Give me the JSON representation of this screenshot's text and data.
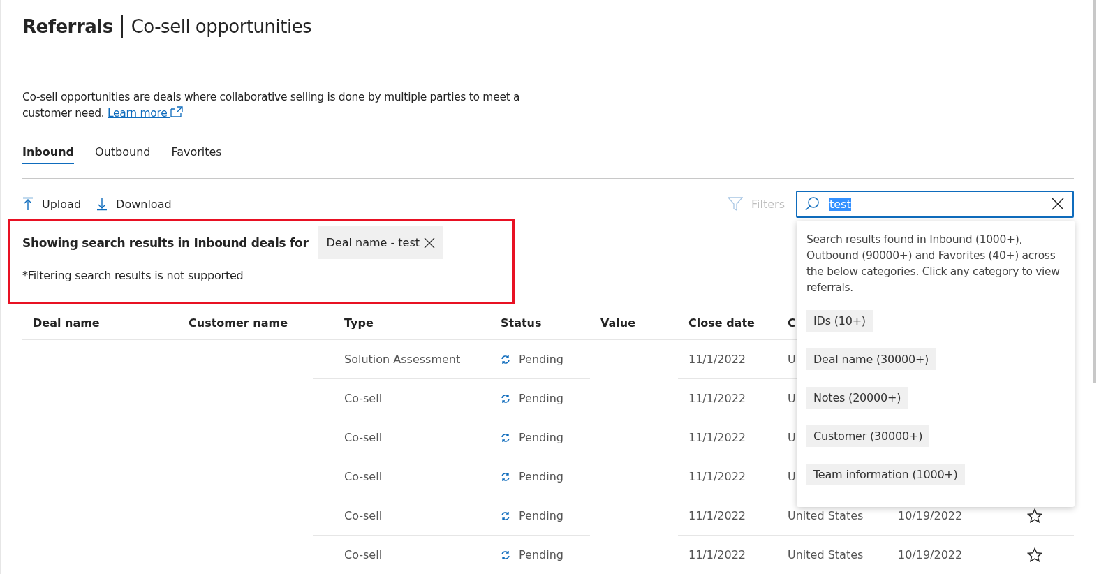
{
  "header": {
    "title": "Referrals",
    "subtitle": "Co-sell opportunities"
  },
  "description": {
    "text": "Co-sell opportunities are deals where collaborative selling is done by multiple parties to meet a customer need.",
    "link": "Learn more"
  },
  "tabs": [
    {
      "label": "Inbound",
      "selected": true
    },
    {
      "label": "Outbound",
      "selected": false
    },
    {
      "label": "Favorites",
      "selected": false
    }
  ],
  "toolbar": {
    "upload": "Upload",
    "download": "Download",
    "filters": {
      "label": "Filters",
      "disabled": true
    }
  },
  "search": {
    "value": "test"
  },
  "search_results": {
    "heading": "Showing search results in Inbound deals for",
    "chip": "Deal name - test",
    "note": "*Filtering search results is not supported"
  },
  "suggestions": {
    "message": "Search results found in Inbound (1000+), Outbound (90000+) and Favorites (40+) across the below categories. Click any category to view referrals.",
    "categories": [
      "IDs (10+)",
      "Deal name (30000+)",
      "Notes (20000+)",
      "Customer (30000+)",
      "Team information (1000+)"
    ]
  },
  "table": {
    "columns": [
      "Deal name",
      "Customer name",
      "Type",
      "Status",
      "Value",
      "Close date",
      "C"
    ],
    "rows": [
      {
        "type": "Solution Assessment",
        "status": "Pending",
        "close_date": "11/1/2022",
        "country": "U"
      },
      {
        "type": "Co-sell",
        "status": "Pending",
        "close_date": "11/1/2022",
        "country": "U"
      },
      {
        "type": "Co-sell",
        "status": "Pending",
        "close_date": "11/1/2022",
        "country": "U"
      },
      {
        "type": "Co-sell",
        "status": "Pending",
        "close_date": "11/1/2022",
        "country": "U"
      },
      {
        "type": "Co-sell",
        "status": "Pending",
        "close_date": "11/1/2022",
        "country": "United States",
        "created_date": "10/19/2022",
        "starred": false
      },
      {
        "type": "Co-sell",
        "status": "Pending",
        "close_date": "11/1/2022",
        "country": "United States",
        "created_date": "10/19/2022",
        "starred": false
      }
    ]
  }
}
